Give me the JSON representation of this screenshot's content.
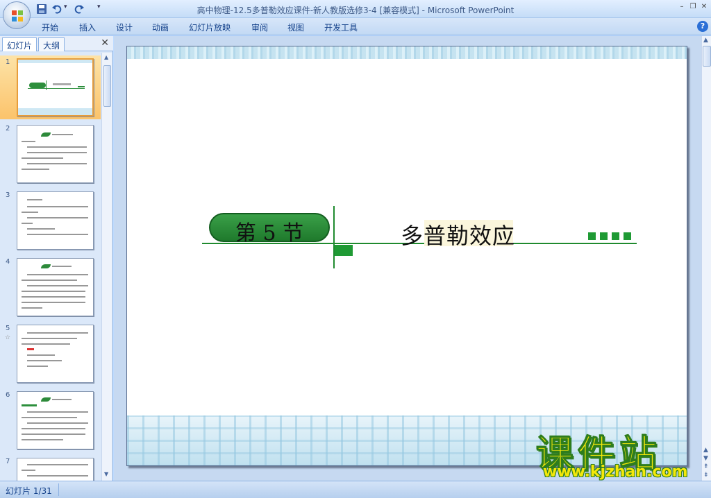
{
  "window": {
    "title": "高中物理-12.5多普勒效应课件-新人教版选修3-4 [兼容模式]",
    "app_name": "Microsoft PowerPoint",
    "controls": {
      "minimize": "–",
      "restore": "❐",
      "close": "✕"
    }
  },
  "quick_access": {
    "save_icon": "save-icon",
    "undo_icon": "undo-icon",
    "redo_icon": "repeat-icon",
    "customize_glyph": "▾"
  },
  "ribbon": {
    "tabs": [
      "开始",
      "插入",
      "设计",
      "动画",
      "幻灯片放映",
      "审阅",
      "视图",
      "开发工具"
    ],
    "help_label": "?"
  },
  "left_pane": {
    "tabs": [
      "幻灯片",
      "大纲"
    ],
    "close_glyph": "✕",
    "slides": [
      {
        "number": "1",
        "selected": true
      },
      {
        "number": "2",
        "selected": false
      },
      {
        "number": "3",
        "selected": false
      },
      {
        "number": "4",
        "selected": false
      },
      {
        "number": "5",
        "selected": false
      },
      {
        "number": "6",
        "selected": false
      },
      {
        "number": "7",
        "selected": false
      }
    ]
  },
  "slide": {
    "section_label": "第 5 节",
    "title": "多普勒效应",
    "colors": {
      "accent": "#1f9a34",
      "pill": "#2d8f3c",
      "highlight": "#fbf6dc"
    }
  },
  "watermark": {
    "text": "课件站",
    "url": "www.kjzhan.com"
  },
  "status": {
    "slide_indicator": "幻灯片 1/31"
  }
}
